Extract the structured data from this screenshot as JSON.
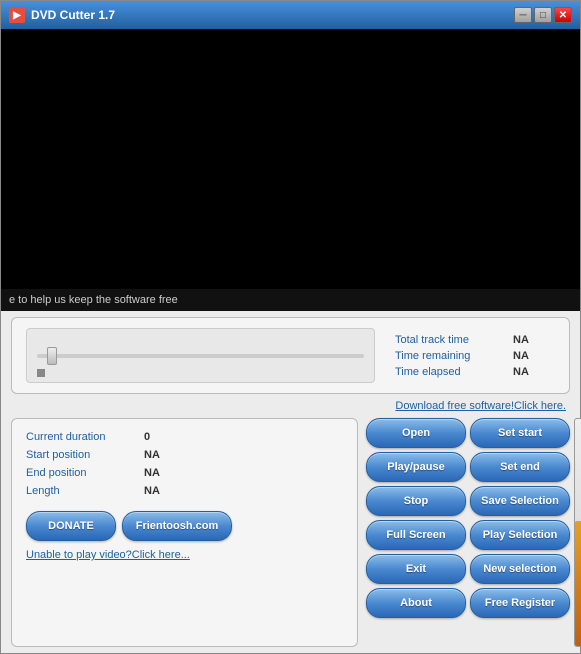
{
  "window": {
    "title": "DVD Cutter 1.7",
    "title_btn_min": "─",
    "title_btn_max": "□",
    "title_btn_close": "✕"
  },
  "ticker": {
    "text": "e to help us keep the software free"
  },
  "track_info": {
    "total_track_time_label": "Total  track time",
    "total_track_time_value": "NA",
    "time_remaining_label": "Time remaining",
    "time_remaining_value": "NA",
    "time_elapsed_label": "Time elapsed",
    "time_elapsed_value": "NA"
  },
  "download_link": "Download free software!Click here.",
  "info_panel": {
    "current_duration_label": "Current duration",
    "current_duration_value": "0",
    "start_position_label": "Start position",
    "start_position_value": "NA",
    "end_position_label": "End position",
    "end_position_value": "NA",
    "length_label": "Length",
    "length_value": "NA"
  },
  "buttons": {
    "open": "Open",
    "set_start": "Set start",
    "play_pause": "Play/pause",
    "set_end": "Set end",
    "stop": "Stop",
    "save_selection": "Save Selection",
    "full_screen": "Full Screen",
    "play_selection": "Play Selection",
    "exit": "Exit",
    "new_selection": "New selection",
    "about": "About",
    "free_register": "Free Register",
    "donate": "DONATE",
    "frientoosh": "Frientoosh.com"
  },
  "links": {
    "unable_to_play": "Unable to play video?Click here..."
  },
  "battery": {
    "fill_percent": 55
  }
}
